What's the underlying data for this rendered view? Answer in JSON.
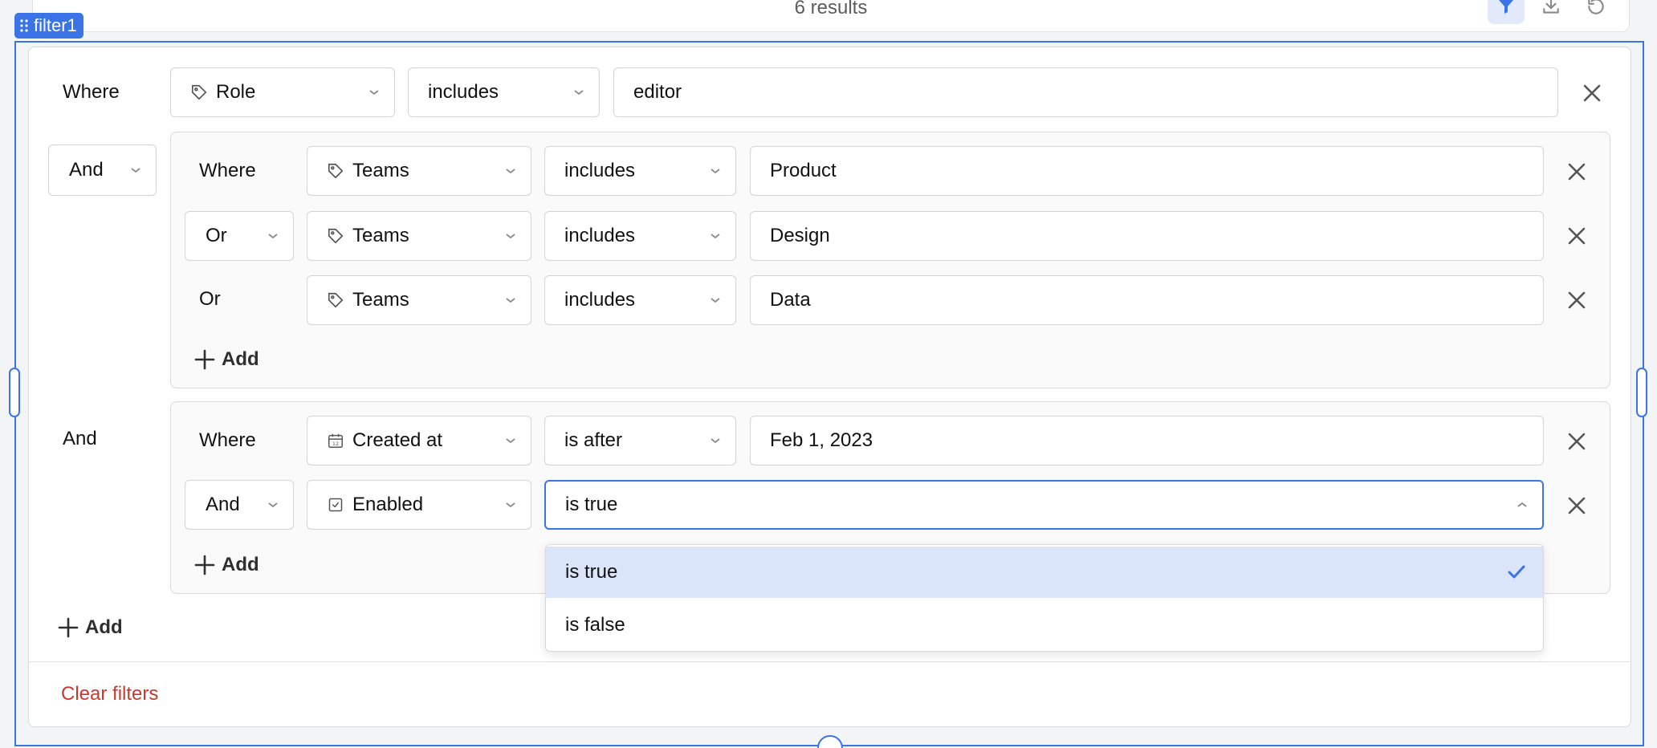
{
  "toolbar": {
    "results_text": "6 results",
    "icons": [
      "filter-icon",
      "download-icon",
      "refresh-icon"
    ],
    "accent": "#3b74e6"
  },
  "component": {
    "tag": "filter1"
  },
  "filters": {
    "row1": {
      "prefix": "Where",
      "field": "Role",
      "field_icon": "tag-icon",
      "operator": "includes",
      "value": "editor"
    },
    "group1": {
      "joiner": "And",
      "rows": [
        {
          "prefix": "Where",
          "field": "Teams",
          "field_icon": "tag-icon",
          "operator": "includes",
          "value": "Product"
        },
        {
          "prefix": "Or",
          "field": "Teams",
          "field_icon": "tag-icon",
          "operator": "includes",
          "value": "Design"
        },
        {
          "prefix": "Or",
          "field": "Teams",
          "field_icon": "tag-icon",
          "operator": "includes",
          "value": "Data"
        }
      ],
      "add_label": "Add"
    },
    "group2": {
      "joiner": "And",
      "rows": [
        {
          "prefix": "Where",
          "field": "Created at",
          "field_icon": "calendar-icon",
          "operator": "is after",
          "value": "Feb 1, 2023"
        },
        {
          "prefix": "And",
          "field": "Enabled",
          "field_icon": "checkbox-icon",
          "operator": "is true"
        }
      ],
      "add_label": "Add"
    },
    "add_label": "Add",
    "clear_label": "Clear filters"
  },
  "dropdown": {
    "options": [
      {
        "label": "is true",
        "selected": true
      },
      {
        "label": "is false",
        "selected": false
      }
    ]
  },
  "colors": {
    "danger": "#c63a2e",
    "selected_bg": "#dbe5f9"
  }
}
